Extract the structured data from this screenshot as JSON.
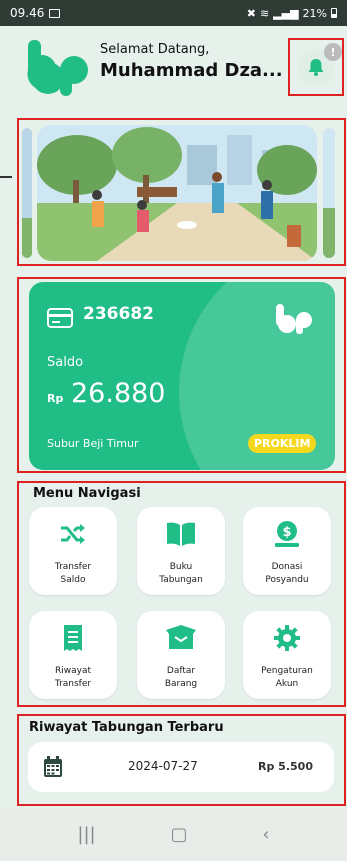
{
  "status_bar": {
    "time": "09.46",
    "battery": "21%"
  },
  "header": {
    "greeting": "Selamat Datang,",
    "user_name": "Muhammad Dza...",
    "notification_badge": "!"
  },
  "card": {
    "account_id": "236682",
    "saldo_label": "Saldo",
    "currency": "Rp",
    "balance": "26.880",
    "location": "Subur Beji Timur",
    "badge": "PROKLIM"
  },
  "menu": {
    "title": "Menu Navigasi",
    "items": [
      {
        "label_1": "Transfer",
        "label_2": "Saldo",
        "icon": "shuffle-icon"
      },
      {
        "label_1": "Buku",
        "label_2": "Tabungan",
        "icon": "book-icon"
      },
      {
        "label_1": "Donasi",
        "label_2": "Posyandu",
        "icon": "donate-icon"
      },
      {
        "label_1": "Riwayat",
        "label_2": "Transfer",
        "icon": "receipt-icon"
      },
      {
        "label_1": "Daftar",
        "label_2": "Barang",
        "icon": "box-icon"
      },
      {
        "label_1": "Pengaturan",
        "label_2": "Akun",
        "icon": "gear-icon"
      }
    ]
  },
  "history": {
    "title": "Riwayat Tabungan Terbaru",
    "date": "2024-07-27",
    "amount": "Rp 5.500"
  },
  "colors": {
    "brand": "#21bd86",
    "badge": "#f3d81e",
    "highlight": "#dd2222"
  }
}
